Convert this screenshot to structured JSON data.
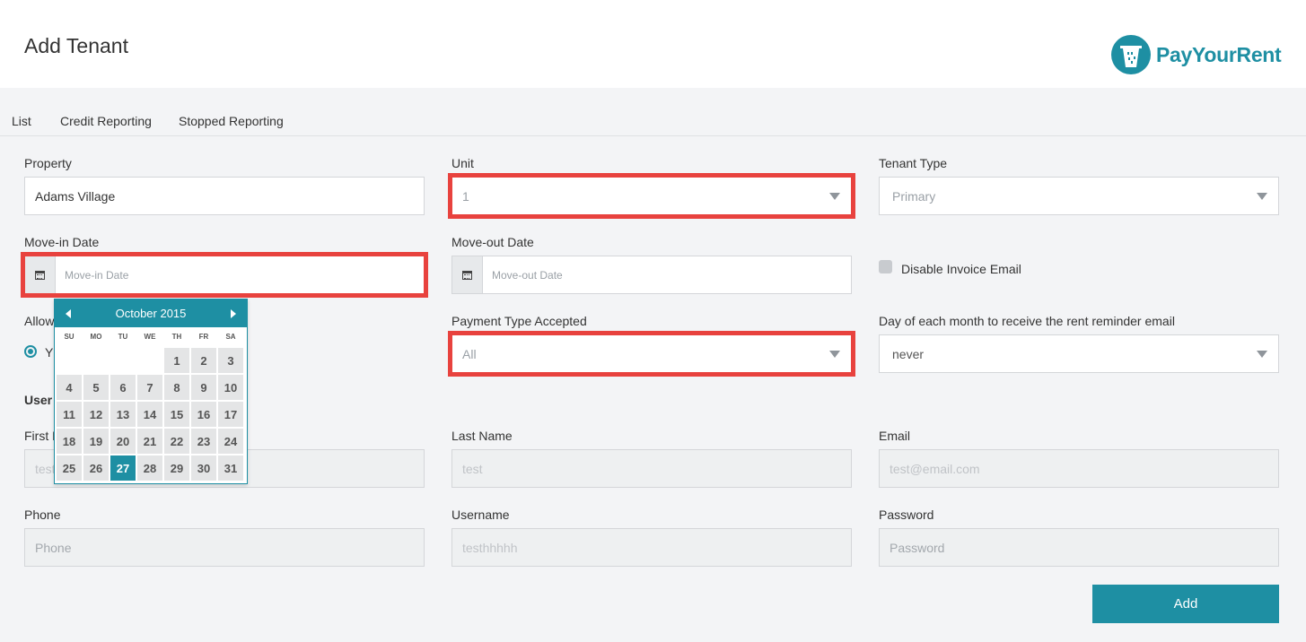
{
  "header": {
    "title": "Add Tenant",
    "logo_text": "PayYourRent"
  },
  "tabs": [
    "List",
    "Credit Reporting",
    "Stopped Reporting"
  ],
  "form": {
    "property": {
      "label": "Property",
      "value": "Adams Village"
    },
    "unit": {
      "label": "Unit",
      "value": "1"
    },
    "tenant_type": {
      "label": "Tenant Type",
      "value": "Primary"
    },
    "move_in": {
      "label": "Move-in Date",
      "placeholder": "Move-in Date"
    },
    "move_out": {
      "label": "Move-out Date",
      "placeholder": "Move-out Date"
    },
    "disable_invoice": {
      "label": "Disable Invoice Email"
    },
    "allow_label_partial": "Allow",
    "radio_partial": "Y",
    "payment_type": {
      "label": "Payment Type Accepted",
      "value": "All"
    },
    "reminder_day": {
      "label": "Day of each month to receive the rent reminder email",
      "value": "never"
    },
    "user_section_partial": "User",
    "first_name": {
      "label_partial": "First N",
      "value_partial": "test"
    },
    "last_name": {
      "label": "Last Name",
      "value": "test"
    },
    "email": {
      "label": "Email",
      "value": "test@email.com"
    },
    "phone": {
      "label": "Phone",
      "placeholder": "Phone"
    },
    "username": {
      "label": "Username",
      "value": "testhhhhh"
    },
    "password": {
      "label": "Password",
      "placeholder": "Password"
    },
    "submit_label": "Add"
  },
  "datepicker": {
    "title": "October 2015",
    "weekdays": [
      "SU",
      "MO",
      "TU",
      "WE",
      "TH",
      "FR",
      "SA"
    ],
    "leading_blanks": 4,
    "days": [
      "1",
      "2",
      "3",
      "4",
      "5",
      "6",
      "7",
      "8",
      "9",
      "10",
      "11",
      "12",
      "13",
      "14",
      "15",
      "16",
      "17",
      "18",
      "19",
      "20",
      "21",
      "22",
      "23",
      "24",
      "25",
      "26",
      "27",
      "28",
      "29",
      "30",
      "31"
    ],
    "selected": "27"
  },
  "colors": {
    "accent": "#1e8fa3",
    "highlight": "#e8423e"
  }
}
